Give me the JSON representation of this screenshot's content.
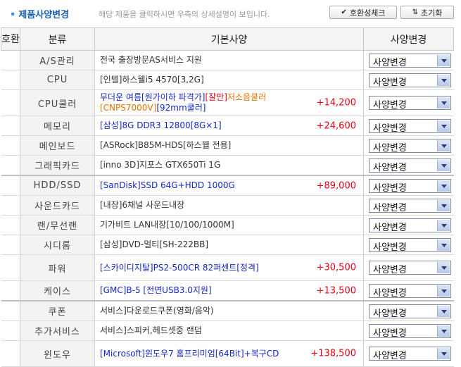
{
  "header": {
    "title_bullet": "•",
    "title": "제품사양변경",
    "subtitle": "해당 제품을 클릭하시면 우측의 상세설명이 보입니다.",
    "compat_button": "호환성체크",
    "compat_icon": "check-icon",
    "reset_button": "초기화",
    "reset_icon": "swap-arrows-icon"
  },
  "columns": {
    "compat": "호환",
    "category": "분류",
    "basic": "기본사양",
    "change": "사양변경"
  },
  "colors": {
    "price": "#e60012",
    "blue_text": "#1528c4",
    "orange_text": "#e07600"
  },
  "rows": [
    {
      "category": "A/S관리",
      "parts": [
        {
          "text": "전국 출장방문AS서비스 지원",
          "color": ""
        }
      ],
      "price": "",
      "select": "사양변경"
    },
    {
      "category": "CPU",
      "parts": [
        {
          "text": "[인텔]하스웰i5 4570[3,2G]",
          "color": ""
        }
      ],
      "price": "",
      "select": "사양변경"
    },
    {
      "category": "CPU쿨러",
      "parts": [
        {
          "text": "무더운 여름[원가이하 파격가]",
          "color": "blue"
        },
        {
          "text": "[잘만]",
          "color": "red"
        },
        {
          "text": "저소음쿨러[CNPS7000V]",
          "color": "orange"
        },
        {
          "text": "[92mm쿨러]",
          "color": "blue"
        }
      ],
      "price": "+14,200",
      "select": "사양변경"
    },
    {
      "category": "메모리",
      "parts": [
        {
          "text": "[삼성]8G DDR3 12800[8G×1]",
          "color": "blue"
        }
      ],
      "price": "+24,600",
      "select": "사양변경"
    },
    {
      "category": "메인보드",
      "parts": [
        {
          "text": "[ASRock]B85M-HDS[하스웰 전용]",
          "color": ""
        }
      ],
      "price": "",
      "select": "사양변경"
    },
    {
      "category": "그래픽카드",
      "parts": [
        {
          "text": "[inno 3D]지포스 GTX650Ti 1G",
          "color": ""
        }
      ],
      "price": "",
      "select": "사양변경"
    },
    {
      "category": "HDD/SSD",
      "parts": [
        {
          "text": "[SanDisk]SSD 64G+HDD 1000G",
          "color": "blue"
        }
      ],
      "price": "+89,000",
      "select": "사양변경"
    },
    {
      "category": "사운드카드",
      "parts": [
        {
          "text": "[내장]6채널 사운드내장",
          "color": ""
        }
      ],
      "price": "",
      "select": "사양변경"
    },
    {
      "category": "랜/무선랜",
      "parts": [
        {
          "text": "기가비트 LAN내장[10/100/1000M]",
          "color": ""
        }
      ],
      "price": "",
      "select": "사양변경"
    },
    {
      "category": "시디롬",
      "parts": [
        {
          "text": "[삼성]DVD-멀티[SH-222BB]",
          "color": ""
        }
      ],
      "price": "",
      "select": "사양변경"
    },
    {
      "category": "파워",
      "parts": [
        {
          "text": "[스카이디지탈]PS2-500CR 82퍼센트[정격]",
          "color": "blue"
        }
      ],
      "price": "+30,500",
      "select": "사양변경"
    },
    {
      "category": "케이스",
      "parts": [
        {
          "text": "[GMC]B-5 [전면USB3.0지원]",
          "color": "blue"
        }
      ],
      "price": "+13,500",
      "select": "사양변경"
    },
    {
      "category": "쿠폰",
      "parts": [
        {
          "text": "서비스]다운로드쿠폰(영화/음악)",
          "color": ""
        }
      ],
      "price": "",
      "select": "사양변경"
    },
    {
      "category": "추가서비스",
      "parts": [
        {
          "text": "서비스]스피커,헤드셋중 랜덤",
          "color": ""
        }
      ],
      "price": "",
      "select": "사양변경"
    },
    {
      "category": "윈도우",
      "parts": [
        {
          "text": "[Microsoft]윈도우7 홈프리미엄[64Bit]+복구CD",
          "color": "blue"
        }
      ],
      "price": "+138,500",
      "select": "사양변경"
    }
  ]
}
